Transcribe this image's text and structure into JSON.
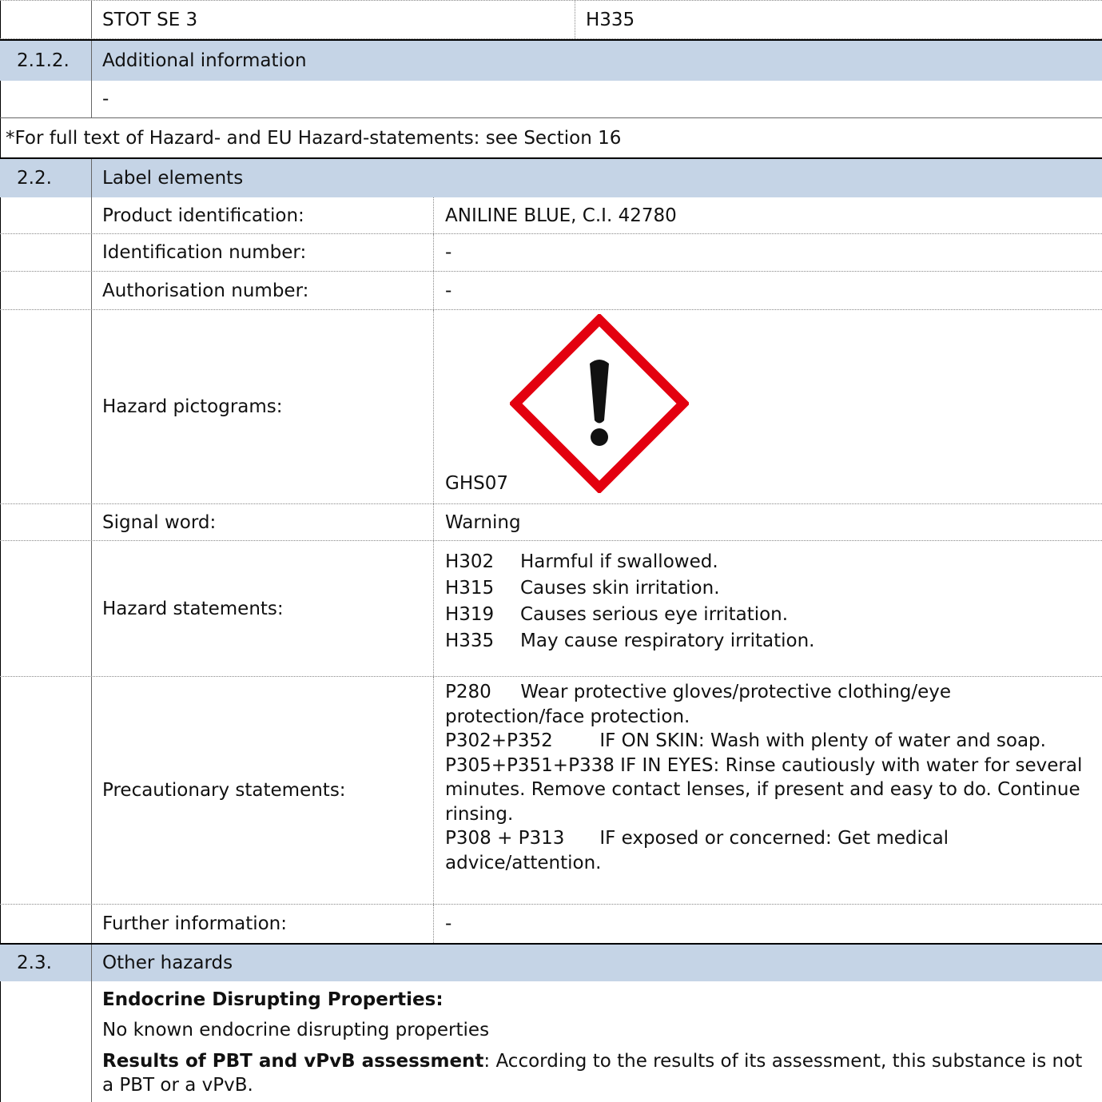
{
  "classification_row": {
    "class": "STOT SE 3",
    "hcode": "H335"
  },
  "sec_212": {
    "number": "2.1.2.",
    "title": "Additional information",
    "value": "-"
  },
  "footnote": "*For full text of Hazard- and EU Hazard-statements: see Section 16",
  "sec_22": {
    "number": "2.2.",
    "title": "Label elements",
    "product_id_label": "Product identification:",
    "product_id": "ANILINE BLUE, C.I. 42780",
    "ident_label": "Identification number:",
    "ident": "-",
    "auth_label": "Authorisation number:",
    "auth": "-",
    "pictogram_label": "Hazard pictograms:",
    "pictogram_code": "GHS07",
    "signal_label": "Signal word:",
    "signal": "Warning",
    "hazard_label": "Hazard statements:",
    "hazards": [
      {
        "code": "H302",
        "text": "Harmful if swallowed."
      },
      {
        "code": "H315",
        "text": "Causes skin irritation."
      },
      {
        "code": "H319",
        "text": "Causes serious eye irritation."
      },
      {
        "code": "H335",
        "text": "May cause respiratory irritation."
      }
    ],
    "precaution_label": "Precautionary statements:",
    "precautions": [
      {
        "code": "P280",
        "text": "Wear protective gloves/protective clothing/eye protection/face protection."
      },
      {
        "code": "P302+P352",
        "text": "IF ON SKIN: Wash with plenty of water and soap."
      },
      {
        "code": "P305+P351+P338",
        "text": "IF IN EYES: Rinse cautiously with water for several minutes. Remove contact lenses, if present and easy to do. Continue rinsing."
      },
      {
        "code": "P308 + P313",
        "text": "IF exposed or concerned: Get medical advice/attention."
      }
    ],
    "further_label": "Further information:",
    "further": "-"
  },
  "sec_23": {
    "number": "2.3.",
    "title": "Other hazards",
    "endocrine_heading": "Endocrine Disrupting Properties:",
    "endocrine_text": "No known endocrine disrupting properties",
    "pbt_heading": "Results of PBT and vPvB assessment",
    "pbt_text": ":  According to the results of its assessment, this substance is not a PBT or a vPvB."
  },
  "colors": {
    "section_band": "#c5d4e6",
    "pictogram_red": "#e3000f"
  },
  "icons": {
    "pictogram": "exclamation-mark-diamond-icon"
  }
}
